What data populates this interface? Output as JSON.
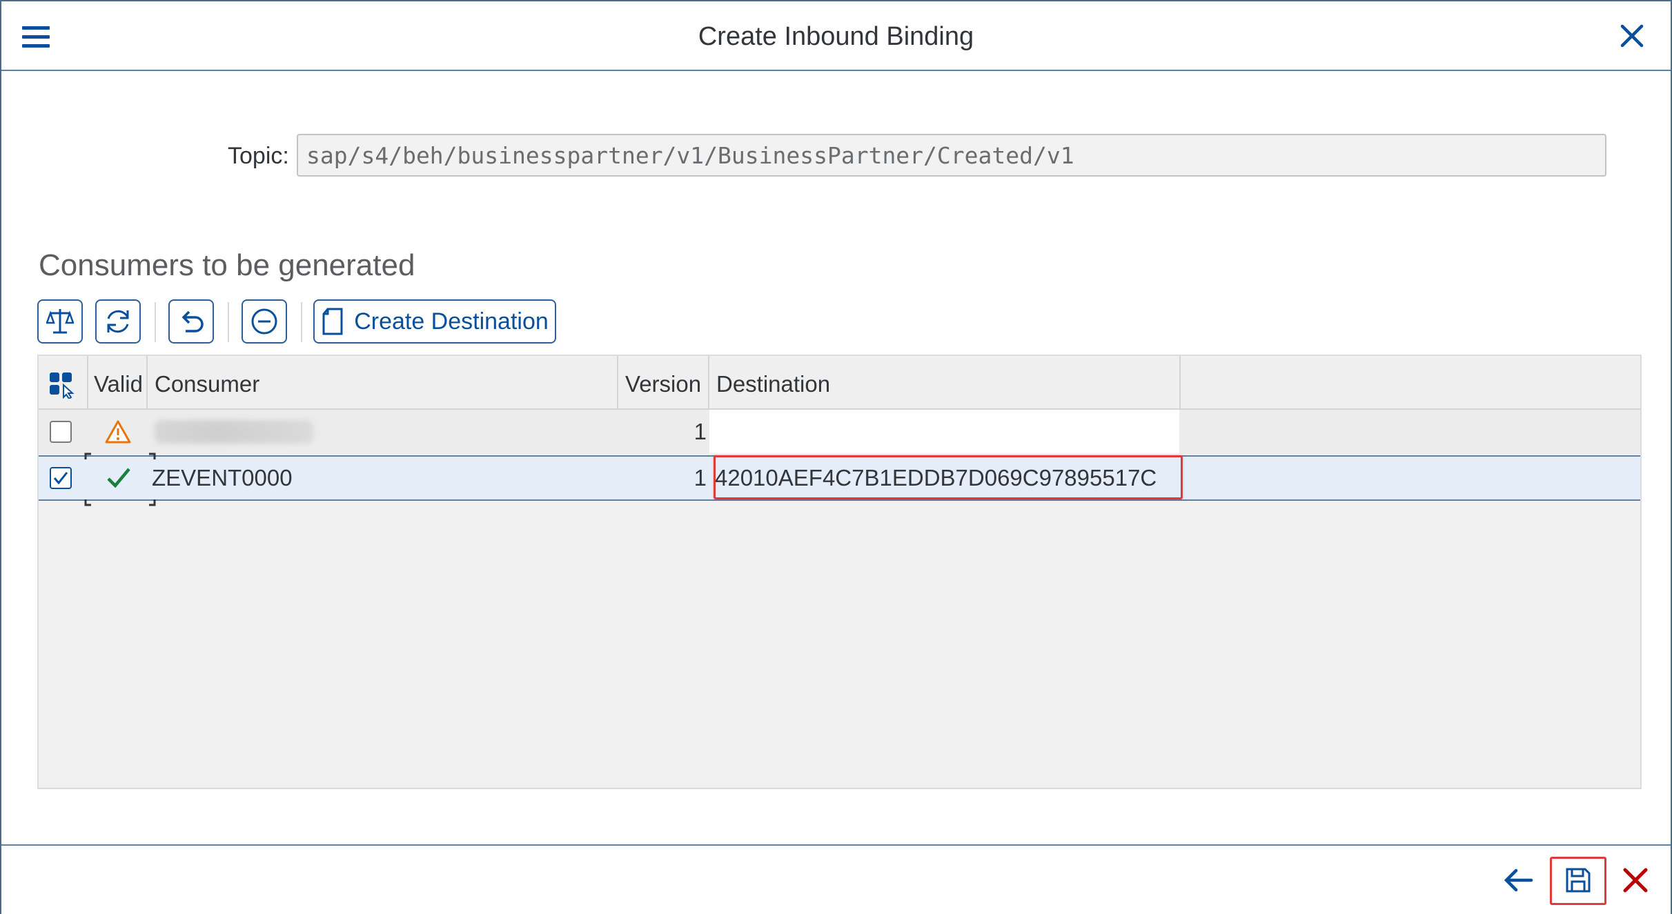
{
  "window": {
    "title": "Create Inbound Binding"
  },
  "topic": {
    "label": "Topic:",
    "value": "sap/s4/beh/businesspartner/v1/BusinessPartner/Created/v1"
  },
  "section": {
    "title": "Consumers to be generated"
  },
  "toolbar": {
    "buttons": [
      {
        "icon": "balance-scale-icon"
      },
      {
        "icon": "refresh-icon"
      },
      {
        "icon": "undo-icon"
      },
      {
        "icon": "remove-icon"
      },
      {
        "icon": "document-icon",
        "label": "Create Destination"
      }
    ]
  },
  "table": {
    "columns": [
      "Valid",
      "Consumer",
      "Version",
      "Destination"
    ],
    "rows": [
      {
        "selected": false,
        "valid_icon": "warning-icon",
        "consumer": "",
        "consumer_blurred": true,
        "version": "1",
        "destination": ""
      },
      {
        "selected": true,
        "valid_icon": "checkmark-icon",
        "consumer": "ZEVENT0000",
        "version": "1",
        "destination": "42010AEF4C7B1EDDB7D069C97895517C"
      }
    ]
  },
  "colors": {
    "accent": "#0a4f9c",
    "highlight": "#e03a3a",
    "success": "#1a7f3c",
    "warning": "#e9730c",
    "cancel": "#bb0000"
  }
}
